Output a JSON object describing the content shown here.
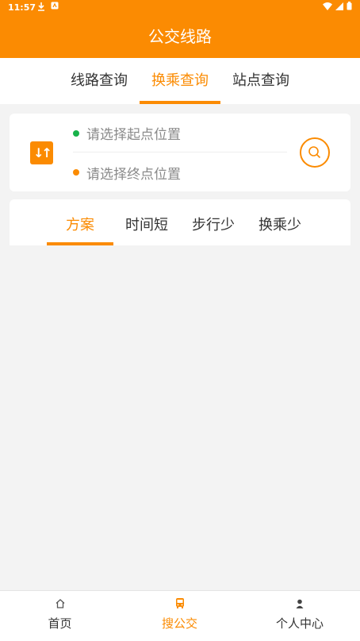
{
  "status_bar": {
    "time": "11:57"
  },
  "header": {
    "title": "公交线路"
  },
  "top_tabs": [
    {
      "label": "线路查询",
      "active": false
    },
    {
      "label": "换乘查询",
      "active": true
    },
    {
      "label": "站点查询",
      "active": false
    }
  ],
  "route_form": {
    "start_placeholder": "请选择起点位置",
    "end_placeholder": "请选择终点位置"
  },
  "plan_tabs": [
    {
      "label": "方案",
      "active": true
    },
    {
      "label": "时间短",
      "active": false
    },
    {
      "label": "步行少",
      "active": false
    },
    {
      "label": "换乘少",
      "active": false
    }
  ],
  "bottom_nav": [
    {
      "label": "首页",
      "icon": "home-icon",
      "active": false
    },
    {
      "label": "搜公交",
      "icon": "bus-icon",
      "active": true
    },
    {
      "label": "个人中心",
      "icon": "person-icon",
      "active": false
    }
  ],
  "colors": {
    "accent": "#fb8b02",
    "start_dot": "#18b24a",
    "end_dot": "#fb8b02",
    "background": "#f3f3f3"
  }
}
